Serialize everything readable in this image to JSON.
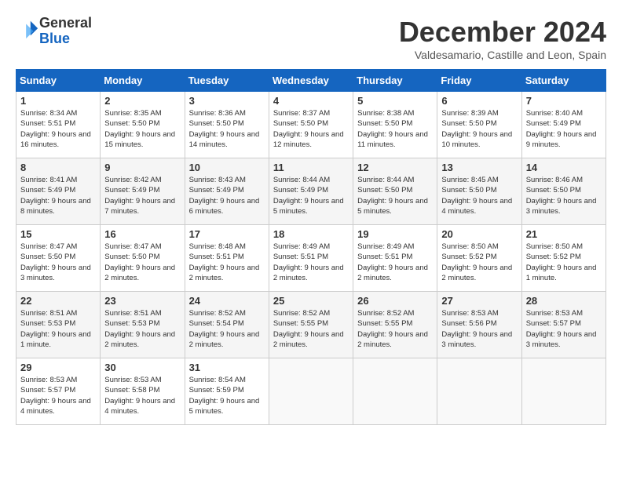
{
  "header": {
    "logo_line1": "General",
    "logo_line2": "Blue",
    "month_title": "December 2024",
    "location": "Valdesamario, Castille and Leon, Spain"
  },
  "weekdays": [
    "Sunday",
    "Monday",
    "Tuesday",
    "Wednesday",
    "Thursday",
    "Friday",
    "Saturday"
  ],
  "weeks": [
    [
      {
        "day": "1",
        "sunrise": "8:34 AM",
        "sunset": "5:51 PM",
        "daylight": "9 hours and 16 minutes."
      },
      {
        "day": "2",
        "sunrise": "8:35 AM",
        "sunset": "5:50 PM",
        "daylight": "9 hours and 15 minutes."
      },
      {
        "day": "3",
        "sunrise": "8:36 AM",
        "sunset": "5:50 PM",
        "daylight": "9 hours and 14 minutes."
      },
      {
        "day": "4",
        "sunrise": "8:37 AM",
        "sunset": "5:50 PM",
        "daylight": "9 hours and 12 minutes."
      },
      {
        "day": "5",
        "sunrise": "8:38 AM",
        "sunset": "5:50 PM",
        "daylight": "9 hours and 11 minutes."
      },
      {
        "day": "6",
        "sunrise": "8:39 AM",
        "sunset": "5:50 PM",
        "daylight": "9 hours and 10 minutes."
      },
      {
        "day": "7",
        "sunrise": "8:40 AM",
        "sunset": "5:49 PM",
        "daylight": "9 hours and 9 minutes."
      }
    ],
    [
      {
        "day": "8",
        "sunrise": "8:41 AM",
        "sunset": "5:49 PM",
        "daylight": "9 hours and 8 minutes."
      },
      {
        "day": "9",
        "sunrise": "8:42 AM",
        "sunset": "5:49 PM",
        "daylight": "9 hours and 7 minutes."
      },
      {
        "day": "10",
        "sunrise": "8:43 AM",
        "sunset": "5:49 PM",
        "daylight": "9 hours and 6 minutes."
      },
      {
        "day": "11",
        "sunrise": "8:44 AM",
        "sunset": "5:49 PM",
        "daylight": "9 hours and 5 minutes."
      },
      {
        "day": "12",
        "sunrise": "8:44 AM",
        "sunset": "5:50 PM",
        "daylight": "9 hours and 5 minutes."
      },
      {
        "day": "13",
        "sunrise": "8:45 AM",
        "sunset": "5:50 PM",
        "daylight": "9 hours and 4 minutes."
      },
      {
        "day": "14",
        "sunrise": "8:46 AM",
        "sunset": "5:50 PM",
        "daylight": "9 hours and 3 minutes."
      }
    ],
    [
      {
        "day": "15",
        "sunrise": "8:47 AM",
        "sunset": "5:50 PM",
        "daylight": "9 hours and 3 minutes."
      },
      {
        "day": "16",
        "sunrise": "8:47 AM",
        "sunset": "5:50 PM",
        "daylight": "9 hours and 2 minutes."
      },
      {
        "day": "17",
        "sunrise": "8:48 AM",
        "sunset": "5:51 PM",
        "daylight": "9 hours and 2 minutes."
      },
      {
        "day": "18",
        "sunrise": "8:49 AM",
        "sunset": "5:51 PM",
        "daylight": "9 hours and 2 minutes."
      },
      {
        "day": "19",
        "sunrise": "8:49 AM",
        "sunset": "5:51 PM",
        "daylight": "9 hours and 2 minutes."
      },
      {
        "day": "20",
        "sunrise": "8:50 AM",
        "sunset": "5:52 PM",
        "daylight": "9 hours and 2 minutes."
      },
      {
        "day": "21",
        "sunrise": "8:50 AM",
        "sunset": "5:52 PM",
        "daylight": "9 hours and 1 minute."
      }
    ],
    [
      {
        "day": "22",
        "sunrise": "8:51 AM",
        "sunset": "5:53 PM",
        "daylight": "9 hours and 1 minute."
      },
      {
        "day": "23",
        "sunrise": "8:51 AM",
        "sunset": "5:53 PM",
        "daylight": "9 hours and 2 minutes."
      },
      {
        "day": "24",
        "sunrise": "8:52 AM",
        "sunset": "5:54 PM",
        "daylight": "9 hours and 2 minutes."
      },
      {
        "day": "25",
        "sunrise": "8:52 AM",
        "sunset": "5:55 PM",
        "daylight": "9 hours and 2 minutes."
      },
      {
        "day": "26",
        "sunrise": "8:52 AM",
        "sunset": "5:55 PM",
        "daylight": "9 hours and 2 minutes."
      },
      {
        "day": "27",
        "sunrise": "8:53 AM",
        "sunset": "5:56 PM",
        "daylight": "9 hours and 3 minutes."
      },
      {
        "day": "28",
        "sunrise": "8:53 AM",
        "sunset": "5:57 PM",
        "daylight": "9 hours and 3 minutes."
      }
    ],
    [
      {
        "day": "29",
        "sunrise": "8:53 AM",
        "sunset": "5:57 PM",
        "daylight": "9 hours and 4 minutes."
      },
      {
        "day": "30",
        "sunrise": "8:53 AM",
        "sunset": "5:58 PM",
        "daylight": "9 hours and 4 minutes."
      },
      {
        "day": "31",
        "sunrise": "8:54 AM",
        "sunset": "5:59 PM",
        "daylight": "9 hours and 5 minutes."
      },
      null,
      null,
      null,
      null
    ]
  ]
}
